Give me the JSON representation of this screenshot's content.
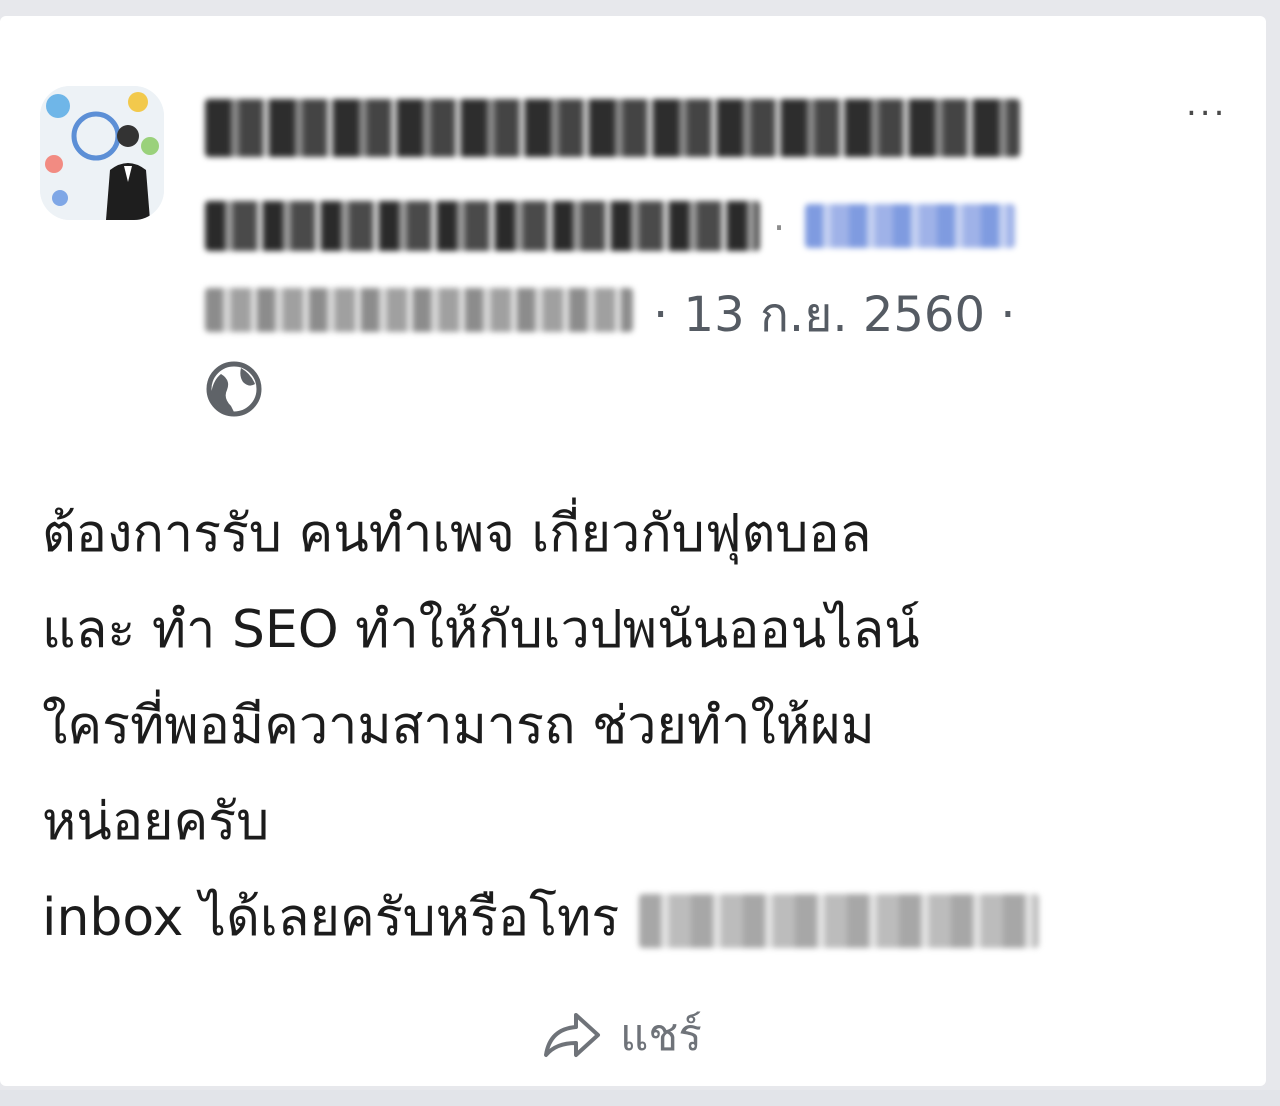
{
  "post": {
    "date": "13 ก.ย. 2560",
    "date_separator": "·",
    "lines": [
      "ต้องการรับ คนทำเพจ เกี่ยวกับฟุตบอล",
      "และ ทำ SEO ทำให้กับเวปพนันออนไลน์",
      "ใครที่พอมีความสามารถ ช่วยทำให้ผม",
      "หน่อยครับ"
    ],
    "contact_line": "inbox ได้เลยครับหรือโทร"
  },
  "actions": {
    "share_label": "แชร์",
    "more_menu": "..."
  },
  "icons": {
    "privacy": "globe-icon",
    "share": "share-arrow-icon",
    "more": "more-dots-icon"
  },
  "colors": {
    "text": "#1c1c1c",
    "meta_text": "#555b63",
    "link_blue": "#7f9be0",
    "background": "#ffffff"
  }
}
